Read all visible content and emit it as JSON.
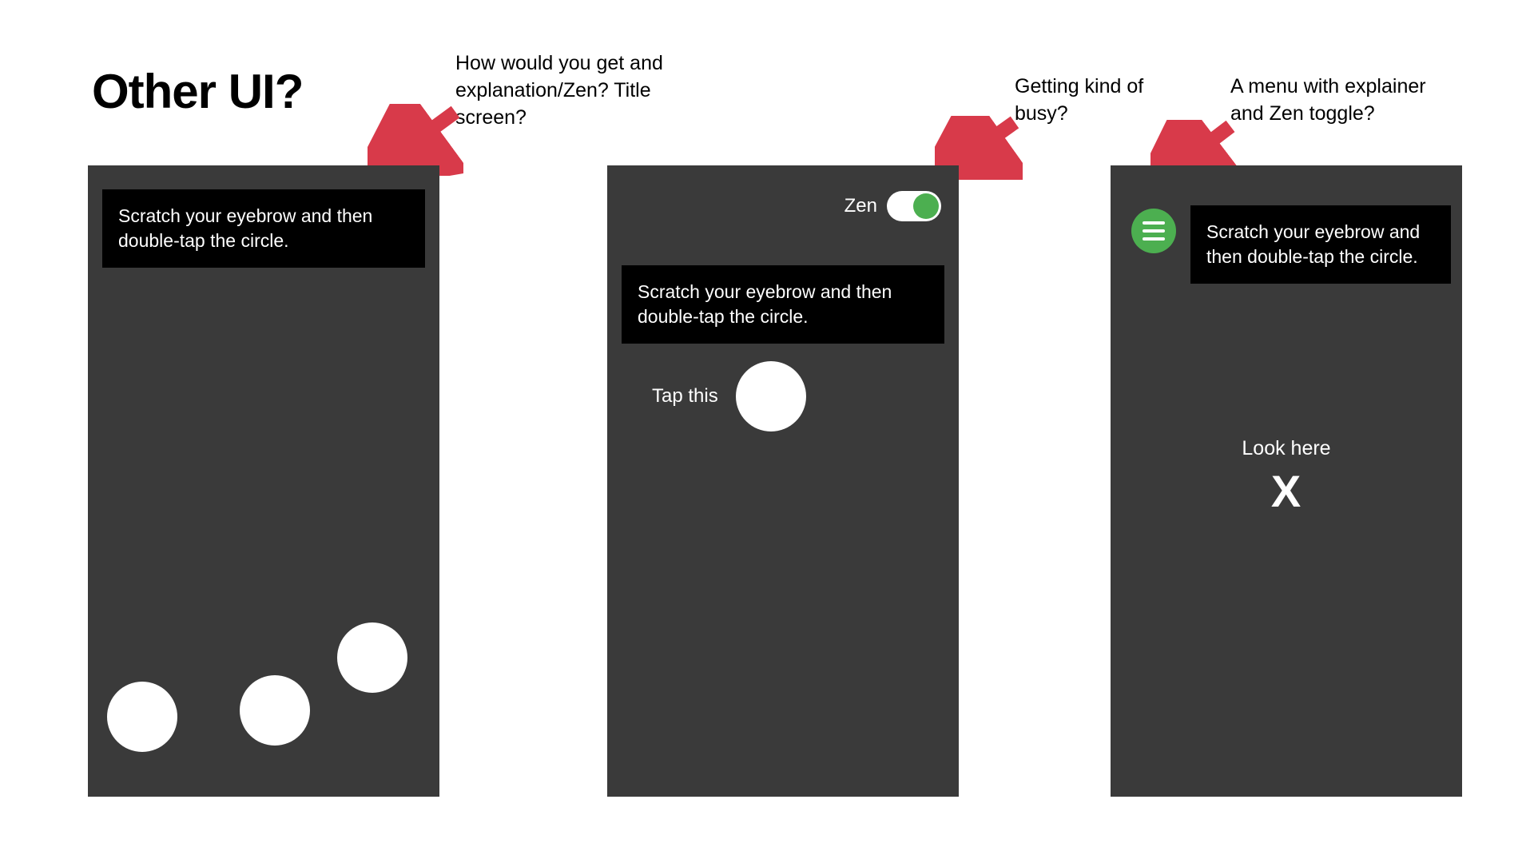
{
  "heading": "Other UI?",
  "annotations": {
    "a1": "How would you get and explanation/Zen? Title screen?",
    "a2": "Getting kind of busy?",
    "a3": "A menu with explainer and Zen toggle?"
  },
  "colors": {
    "phone_bg": "#3a3a3a",
    "instruction_bg": "#000000",
    "accent_green": "#4caf50",
    "arrow_red": "#d83a4a"
  },
  "screens": {
    "s1": {
      "instruction": "Scratch your eyebrow and then double-tap the circle.",
      "dot_count": 3
    },
    "s2": {
      "zen_label": "Zen",
      "zen_on": true,
      "instruction": "Scratch your eyebrow and then double-tap the circle.",
      "tap_label": "Tap this"
    },
    "s3": {
      "menu_icon": "hamburger-icon",
      "instruction": "Scratch your eyebrow and then double-tap the circle.",
      "look_label": "Look here",
      "look_mark": "X"
    }
  }
}
